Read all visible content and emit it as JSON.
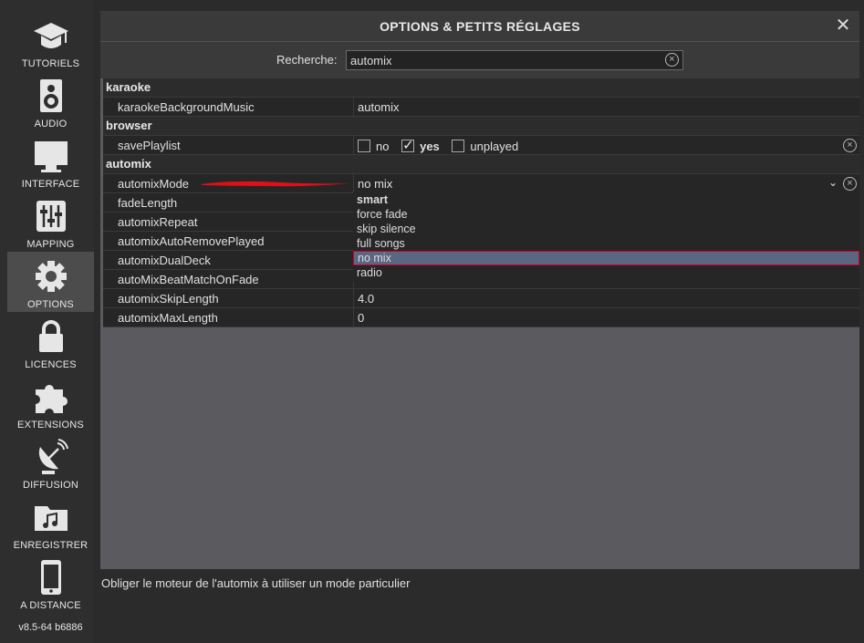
{
  "sidebar": {
    "items": [
      {
        "label": "TUTORIELS",
        "icon": "graduation-cap-icon"
      },
      {
        "label": "AUDIO",
        "icon": "speaker-icon"
      },
      {
        "label": "INTERFACE",
        "icon": "monitor-icon"
      },
      {
        "label": "MAPPING",
        "icon": "sliders-icon"
      },
      {
        "label": "OPTIONS",
        "icon": "gear-icon"
      },
      {
        "label": "LICENCES",
        "icon": "lock-icon"
      },
      {
        "label": "EXTENSIONS",
        "icon": "puzzle-icon"
      },
      {
        "label": "DIFFUSION",
        "icon": "satellite-dish-icon"
      },
      {
        "label": "ENREGISTRER",
        "icon": "music-folder-icon"
      },
      {
        "label": "A DISTANCE",
        "icon": "smartphone-icon"
      }
    ],
    "active": "OPTIONS",
    "version": "v8.5-64 b6886"
  },
  "window": {
    "title": "OPTIONS & PETITS RÉGLAGES",
    "close": "✕"
  },
  "search": {
    "label": "Recherche:",
    "value": "automix"
  },
  "categories": {
    "karaoke": "karaoke",
    "browser": "browser",
    "automix": "automix"
  },
  "rows": {
    "karaokeBackgroundMusic": {
      "name": "karaokeBackgroundMusic",
      "value": "automix"
    },
    "savePlaylist": {
      "name": "savePlaylist",
      "options": [
        "no",
        "yes",
        "unplayed"
      ],
      "selected": "yes"
    },
    "automixMode": {
      "name": "automixMode",
      "value": "no mix"
    },
    "fadeLength": {
      "name": "fadeLength"
    },
    "automixRepeat": {
      "name": "automixRepeat"
    },
    "automixAutoRemovePlayed": {
      "name": "automixAutoRemovePlayed"
    },
    "automixDualDeck": {
      "name": "automixDualDeck"
    },
    "autoMixBeatMatchOnFade": {
      "name": "autoMixBeatMatchOnFade"
    },
    "automixSkipLength": {
      "name": "automixSkipLength",
      "value": "4.0"
    },
    "automixMaxLength": {
      "name": "automixMaxLength",
      "value": "0"
    }
  },
  "dropdown": {
    "options": [
      "smart",
      "force fade",
      "skip silence",
      "full songs",
      "no mix",
      "radio"
    ],
    "default": "smart",
    "selected": "no mix"
  },
  "status": "Obliger le moteur de l'automix à utiliser un mode particulier",
  "colors": {
    "annotation": "#e0101a",
    "selection": "#5b6680"
  }
}
